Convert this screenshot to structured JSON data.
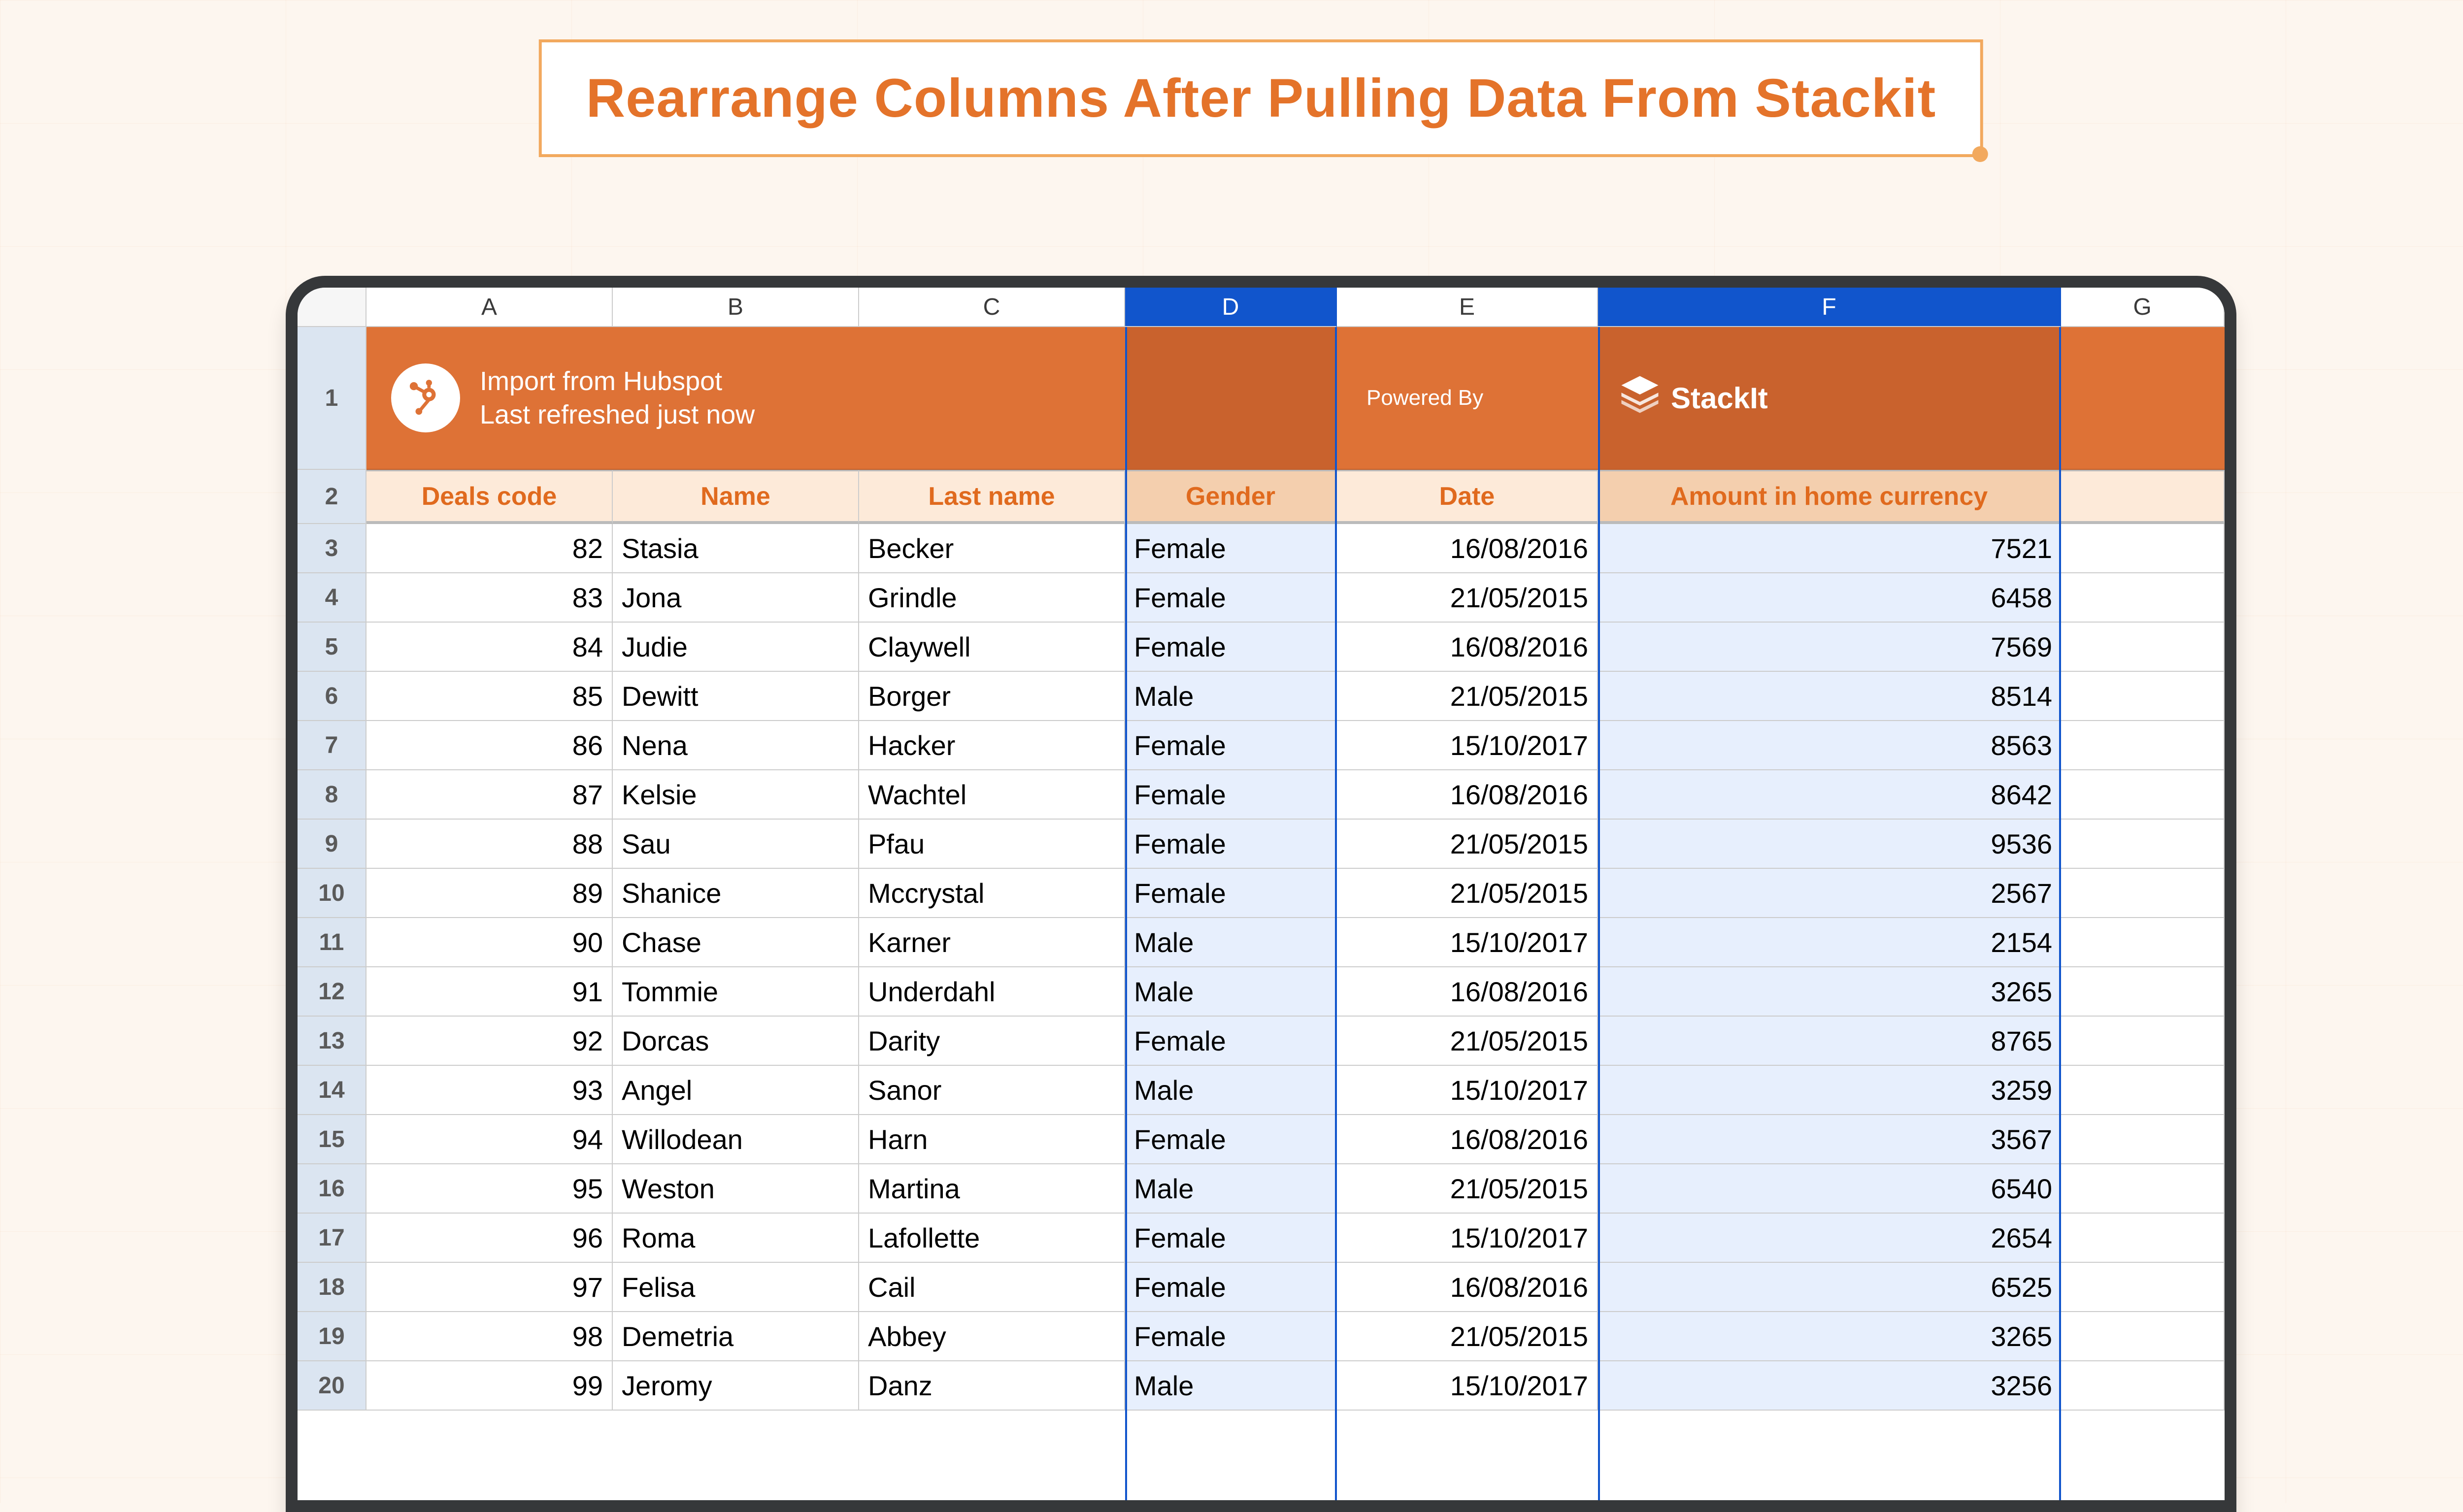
{
  "title": "Rearrange Columns After Pulling Data From Stackit",
  "columns": [
    "A",
    "B",
    "C",
    "D",
    "E",
    "F",
    "G"
  ],
  "selected_columns": [
    "D",
    "F"
  ],
  "banner": {
    "title": "Import from Hubspot",
    "subtitle": "Last refreshed just now",
    "powered_by_label": "Powered By",
    "brand": "StackIt"
  },
  "headers": {
    "A": "Deals code",
    "B": "Name",
    "C": "Last name",
    "D": "Gender",
    "E": "Date",
    "F": "Amount in home currency"
  },
  "rows": [
    {
      "n": "3",
      "code": "82",
      "name": "Stasia",
      "last": "Becker",
      "gender": "Female",
      "date": "16/08/2016",
      "amount": "7521"
    },
    {
      "n": "4",
      "code": "83",
      "name": "Jona",
      "last": "Grindle",
      "gender": "Female",
      "date": "21/05/2015",
      "amount": "6458"
    },
    {
      "n": "5",
      "code": "84",
      "name": "Judie",
      "last": "Claywell",
      "gender": "Female",
      "date": "16/08/2016",
      "amount": "7569"
    },
    {
      "n": "6",
      "code": "85",
      "name": "Dewitt",
      "last": "Borger",
      "gender": "Male",
      "date": "21/05/2015",
      "amount": "8514"
    },
    {
      "n": "7",
      "code": "86",
      "name": "Nena",
      "last": "Hacker",
      "gender": "Female",
      "date": "15/10/2017",
      "amount": "8563"
    },
    {
      "n": "8",
      "code": "87",
      "name": "Kelsie",
      "last": "Wachtel",
      "gender": "Female",
      "date": "16/08/2016",
      "amount": "8642"
    },
    {
      "n": "9",
      "code": "88",
      "name": "Sau",
      "last": "Pfau",
      "gender": "Female",
      "date": "21/05/2015",
      "amount": "9536"
    },
    {
      "n": "10",
      "code": "89",
      "name": "Shanice",
      "last": "Mccrystal",
      "gender": "Female",
      "date": "21/05/2015",
      "amount": "2567"
    },
    {
      "n": "11",
      "code": "90",
      "name": "Chase",
      "last": "Karner",
      "gender": "Male",
      "date": "15/10/2017",
      "amount": "2154"
    },
    {
      "n": "12",
      "code": "91",
      "name": "Tommie",
      "last": "Underdahl",
      "gender": "Male",
      "date": "16/08/2016",
      "amount": "3265"
    },
    {
      "n": "13",
      "code": "92",
      "name": "Dorcas",
      "last": "Darity",
      "gender": "Female",
      "date": "21/05/2015",
      "amount": "8765"
    },
    {
      "n": "14",
      "code": "93",
      "name": "Angel",
      "last": "Sanor",
      "gender": "Male",
      "date": "15/10/2017",
      "amount": "3259"
    },
    {
      "n": "15",
      "code": "94",
      "name": "Willodean",
      "last": "Harn",
      "gender": "Female",
      "date": "16/08/2016",
      "amount": "3567"
    },
    {
      "n": "16",
      "code": "95",
      "name": "Weston",
      "last": "Martina",
      "gender": "Male",
      "date": "21/05/2015",
      "amount": "6540"
    },
    {
      "n": "17",
      "code": "96",
      "name": "Roma",
      "last": "Lafollette",
      "gender": "Female",
      "date": "15/10/2017",
      "amount": "2654"
    },
    {
      "n": "18",
      "code": "97",
      "name": "Felisa",
      "last": "Cail",
      "gender": "Female",
      "date": "16/08/2016",
      "amount": "6525"
    },
    {
      "n": "19",
      "code": "98",
      "name": "Demetria",
      "last": "Abbey",
      "gender": "Female",
      "date": "21/05/2015",
      "amount": "3265"
    },
    {
      "n": "20",
      "code": "99",
      "name": "Jeromy",
      "last": "Danz",
      "gender": "Male",
      "date": "15/10/2017",
      "amount": "3256"
    }
  ]
}
